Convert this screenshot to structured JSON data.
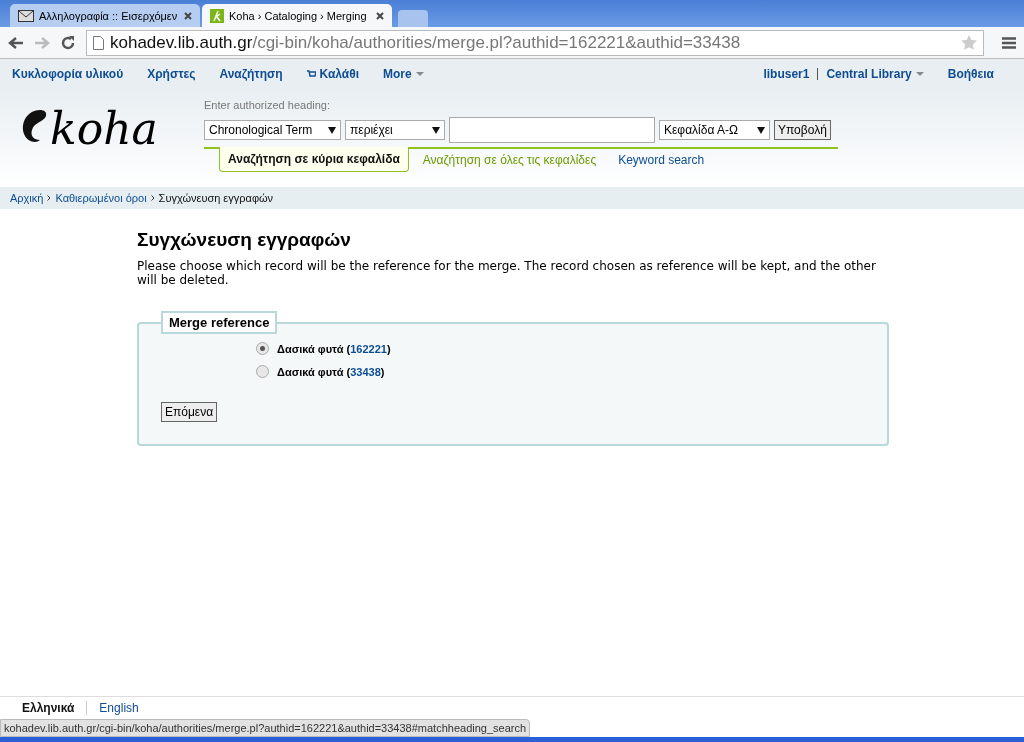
{
  "browser": {
    "tabs": [
      {
        "title": "Αλληλογραφία :: Εισερχόμεν",
        "kind": "mail",
        "selected": false
      },
      {
        "title": "Koha › Cataloging › Merging",
        "kind": "koha",
        "selected": true
      }
    ],
    "address": {
      "host": "kohadev.lib.auth.gr",
      "path": "/cgi-bin/koha/authorities/merge.pl?authid=162221&authid=33438"
    }
  },
  "nav": {
    "left": [
      {
        "label": "Κυκλοφορία υλικού",
        "kind": "plain"
      },
      {
        "label": "Χρήστες",
        "kind": "plain"
      },
      {
        "label": "Αναζήτηση",
        "kind": "plain"
      },
      {
        "label": "Καλάθι",
        "kind": "cart"
      },
      {
        "label": "More",
        "kind": "menu"
      }
    ],
    "user": "libuser1",
    "library": "Central Library",
    "help": "Βοήθεια"
  },
  "search": {
    "logo": "koha",
    "label": "Enter authorized heading:",
    "type_select": "Chronological Term",
    "operator_select": "περιέχει",
    "order_select": "Κεφαλίδα Α-Ω",
    "submit": "Υποβολή",
    "tabs": [
      {
        "label": "Αναζήτηση σε κύρια κεφαλίδα",
        "selected": true
      },
      {
        "label": "Αναζήτηση σε όλες τις κεφαλίδες",
        "selected": false
      },
      {
        "label": "Keyword search",
        "selected": false
      }
    ]
  },
  "breadcrumbs": [
    {
      "label": "Αρχική",
      "link": true
    },
    {
      "label": "Καθιερωμένοι όροι",
      "link": true
    },
    {
      "label": "Συγχώνευση εγγραφών",
      "link": false
    }
  ],
  "page": {
    "title": "Συγχώνευση εγγραφών",
    "intro": "Please choose which record will be the reference for the merge. The record chosen as reference will be kept, and the other will be deleted.",
    "fieldset": {
      "legend": "Merge reference",
      "options": [
        {
          "prefix": "Δασικά φυτά (",
          "id": "162221",
          "suffix": ")",
          "selected": true
        },
        {
          "prefix": "Δασικά φυτά (",
          "id": "33438",
          "suffix": ")",
          "selected": false
        }
      ],
      "button": "Επόμενα"
    }
  },
  "footer": {
    "languages": [
      {
        "label": "Ελληνικά",
        "selected": true
      },
      {
        "label": "English",
        "selected": false
      }
    ]
  },
  "status_bar": "kohadev.lib.auth.gr/cgi-bin/koha/authorities/merge.pl?authid=162221&authid=33438#matchheading_search"
}
